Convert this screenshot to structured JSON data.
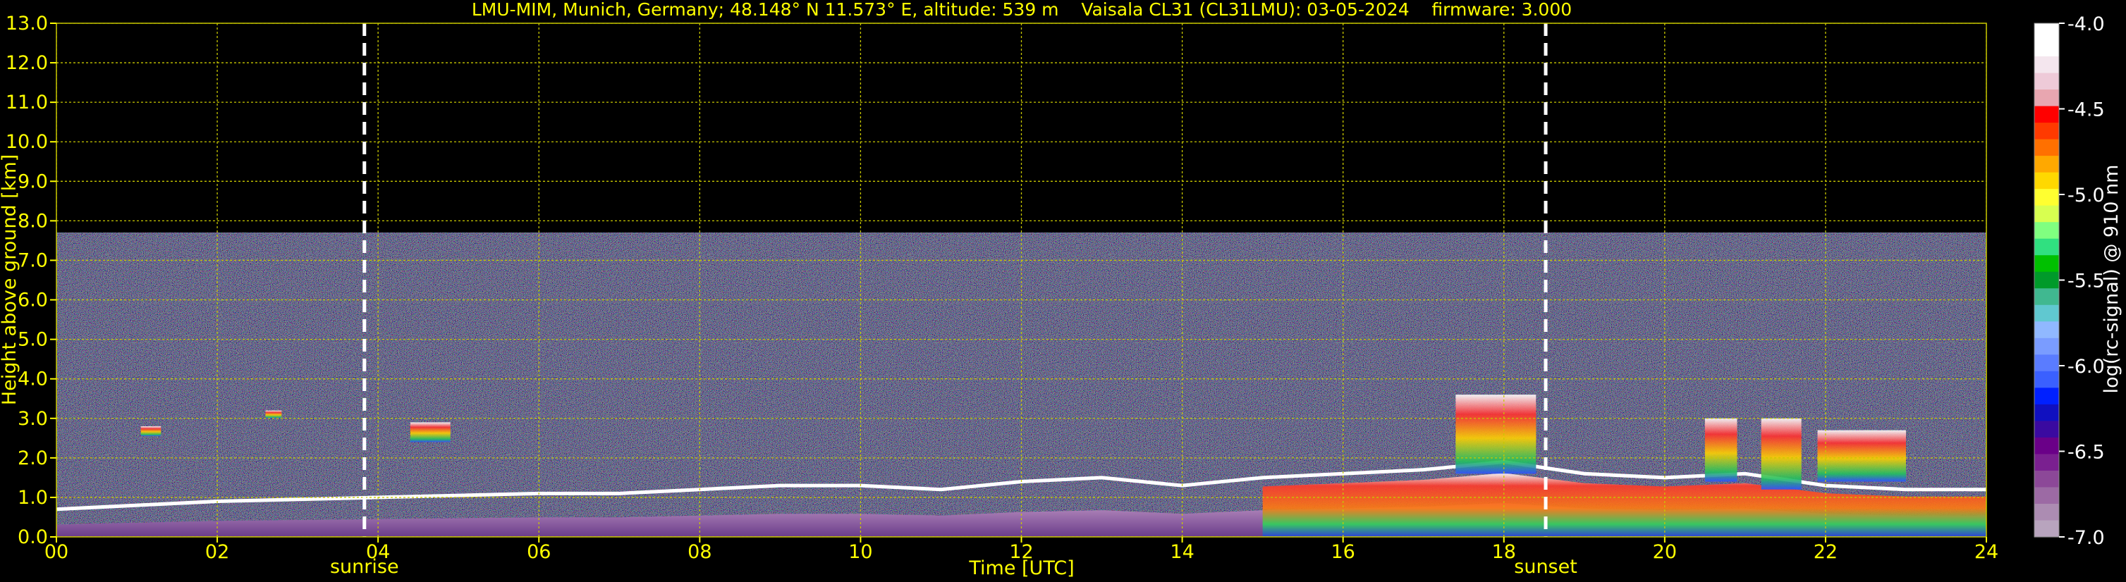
{
  "chart_data": {
    "type": "heatmap",
    "title": "LMU-MIM, Munich, Germany; 48.148° N 11.573° E, altitude: 539 m    Vaisala CL31 (CL31LMU): 03-05-2024    firmware: 3.000",
    "xlabel": "Time [UTC]",
    "ylabel": "Height above ground [km]",
    "xlim": [
      0,
      24
    ],
    "ylim": [
      0,
      13
    ],
    "x_ticks": [
      "00",
      "02",
      "04",
      "06",
      "08",
      "10",
      "12",
      "14",
      "16",
      "18",
      "20",
      "22",
      "24"
    ],
    "y_ticks": [
      "0.0",
      "1.0",
      "2.0",
      "3.0",
      "4.0",
      "5.0",
      "6.0",
      "7.0",
      "8.0",
      "9.0",
      "10.0",
      "11.0",
      "12.0",
      "13.0"
    ],
    "grid": true,
    "annotations": [
      {
        "label": "sunrise",
        "x": 3.83
      },
      {
        "label": "sunset",
        "x": 18.52
      }
    ],
    "colorbar": {
      "label": "log(rc-signal) @ 910 nm",
      "range": [
        -7.0,
        -4.0
      ],
      "ticks": [
        "-4.0",
        "-4.5",
        "-5.0",
        "-5.5",
        "-6.0",
        "-6.5",
        "-7.0"
      ]
    },
    "features": {
      "noise_top_km": 7.7,
      "boundary_layer_km": [
        [
          0,
          0.7
        ],
        [
          1,
          0.8
        ],
        [
          2,
          0.9
        ],
        [
          3,
          0.95
        ],
        [
          4,
          1.0
        ],
        [
          5,
          1.05
        ],
        [
          6,
          1.1
        ],
        [
          7,
          1.1
        ],
        [
          8,
          1.2
        ],
        [
          9,
          1.3
        ],
        [
          10,
          1.3
        ],
        [
          11,
          1.2
        ],
        [
          12,
          1.4
        ],
        [
          13,
          1.5
        ],
        [
          14,
          1.3
        ],
        [
          15,
          1.5
        ],
        [
          16,
          1.6
        ],
        [
          17,
          1.7
        ],
        [
          18,
          1.9
        ],
        [
          19,
          1.6
        ],
        [
          20,
          1.5
        ],
        [
          21,
          1.6
        ],
        [
          22,
          1.3
        ],
        [
          23,
          1.2
        ],
        [
          24,
          1.2
        ]
      ],
      "clouds": [
        {
          "x": [
            1.05,
            1.3
          ],
          "y": [
            2.55,
            2.8
          ]
        },
        {
          "x": [
            2.6,
            2.8
          ],
          "y": [
            3.0,
            3.2
          ]
        },
        {
          "x": [
            4.4,
            4.9
          ],
          "y": [
            2.4,
            2.9
          ]
        },
        {
          "x": [
            17.4,
            18.4
          ],
          "y": [
            1.6,
            3.6
          ]
        },
        {
          "x": [
            20.5,
            20.9
          ],
          "y": [
            1.4,
            3.0
          ]
        },
        {
          "x": [
            21.2,
            21.7
          ],
          "y": [
            1.2,
            3.0
          ]
        },
        {
          "x": [
            21.9,
            23.0
          ],
          "y": [
            1.4,
            2.7
          ]
        }
      ]
    }
  }
}
